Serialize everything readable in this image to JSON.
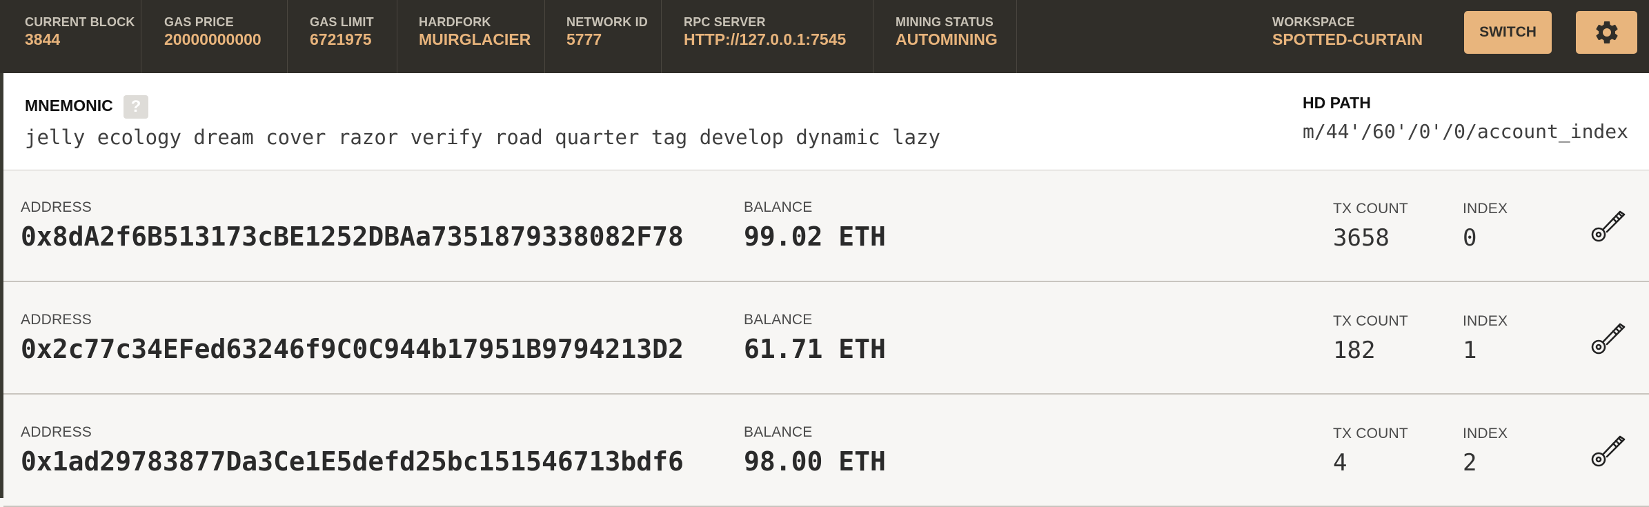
{
  "stats": [
    {
      "label": "CURRENT BLOCK",
      "value": "3844"
    },
    {
      "label": "GAS PRICE",
      "value": "20000000000"
    },
    {
      "label": "GAS LIMIT",
      "value": "6721975"
    },
    {
      "label": "HARDFORK",
      "value": "MUIRGLACIER"
    },
    {
      "label": "NETWORK ID",
      "value": "5777"
    },
    {
      "label": "RPC SERVER",
      "value": "HTTP://127.0.0.1:7545"
    },
    {
      "label": "MINING STATUS",
      "value": "AUTOMINING"
    }
  ],
  "workspace": {
    "label": "WORKSPACE",
    "value": "SPOTTED-CURTAIN"
  },
  "buttons": {
    "switch_label": "SWITCH"
  },
  "icons": {
    "settings": "gear-icon",
    "key": "key-icon",
    "help": "help-icon"
  },
  "mnemonic": {
    "label": "MNEMONIC",
    "help": "?",
    "words": "jelly ecology dream cover razor verify road quarter tag develop dynamic lazy"
  },
  "hd_path": {
    "label": "HD PATH",
    "value": "m/44'/60'/0'/0/account_index"
  },
  "account_labels": {
    "address": "ADDRESS",
    "balance": "BALANCE",
    "tx_count": "TX COUNT",
    "index": "INDEX"
  },
  "accounts": [
    {
      "address": "0x8dA2f6B513173cBE1252DBAa7351879338082F78",
      "balance": "99.02 ETH",
      "tx_count": "3658",
      "index": "0"
    },
    {
      "address": "0x2c77c34EFed63246f9C0C944b17951B9794213D2",
      "balance": "61.71 ETH",
      "tx_count": "182",
      "index": "1"
    },
    {
      "address": "0x1ad29783877Da3Ce1E5defd25bc151546713bdf6",
      "balance": "98.00 ETH",
      "tx_count": "4",
      "index": "2"
    }
  ],
  "colors": {
    "topbar_bg": "#302e29",
    "accent": "#e8b47c",
    "button_bg": "#e8b57d",
    "page_bg": "#f7f6f4"
  }
}
